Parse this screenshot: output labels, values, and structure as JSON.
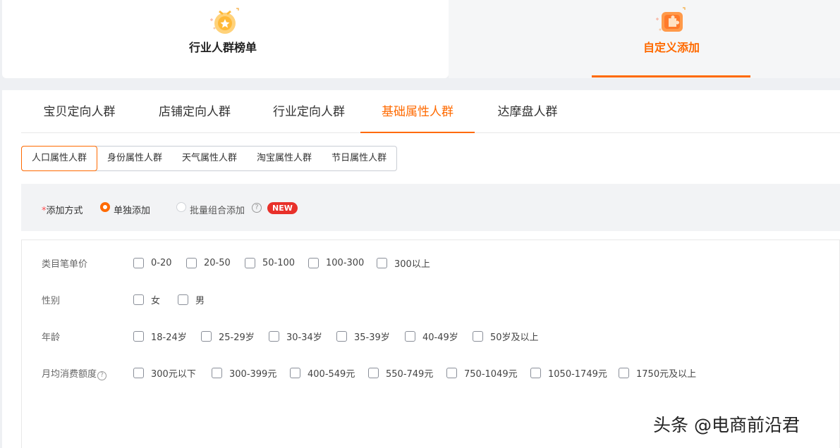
{
  "top_cards": {
    "industry_ranking": "行业人群榜单",
    "custom_add": "自定义添加"
  },
  "tabs": [
    {
      "label": "宝贝定向人群"
    },
    {
      "label": "店铺定向人群"
    },
    {
      "label": "行业定向人群"
    },
    {
      "label": "基础属性人群"
    },
    {
      "label": "达摩盘人群"
    }
  ],
  "subtabs": [
    {
      "label": "人口属性人群"
    },
    {
      "label": "身份属性人群"
    },
    {
      "label": "天气属性人群"
    },
    {
      "label": "淘宝属性人群"
    },
    {
      "label": "节日属性人群"
    }
  ],
  "method": {
    "star": "*",
    "label": "添加方式",
    "single": "单独添加",
    "batch": "批量组合添加",
    "help": "?",
    "new_badge": "NEW"
  },
  "form": {
    "price": {
      "label": "类目笔单价",
      "options": [
        "0-20",
        "20-50",
        "50-100",
        "100-300",
        "300以上"
      ]
    },
    "gender": {
      "label": "性别",
      "options": [
        "女",
        "男"
      ]
    },
    "age": {
      "label": "年龄",
      "options": [
        "18-24岁",
        "25-29岁",
        "30-34岁",
        "35-39岁",
        "40-49岁",
        "50岁及以上"
      ]
    },
    "spend": {
      "label": "月均消费额度",
      "help": "?",
      "options": [
        "300元以下",
        "300-399元",
        "400-549元",
        "550-749元",
        "750-1049元",
        "1050-1749元",
        "1750元及以上"
      ]
    }
  },
  "watermark": "头条 @电商前沿君"
}
